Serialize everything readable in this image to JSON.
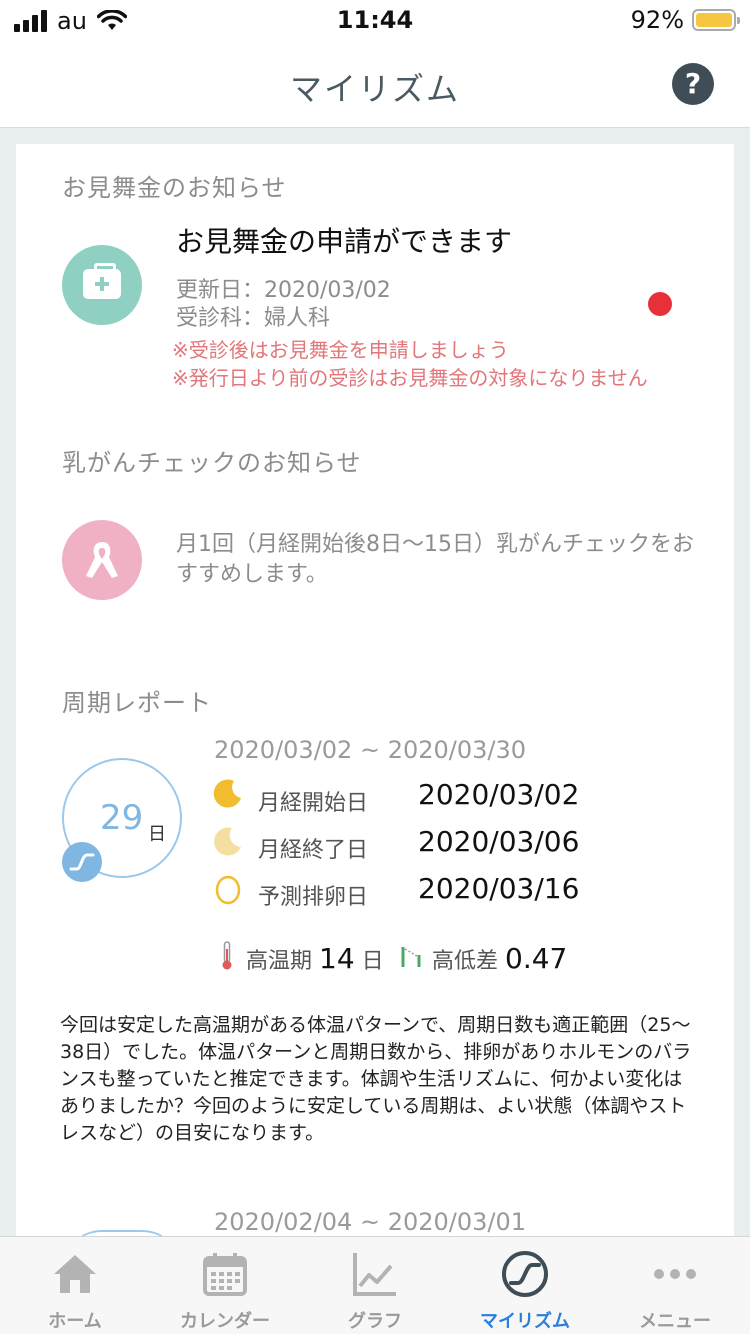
{
  "status_bar": {
    "carrier": "au",
    "time": "11:44",
    "battery": "92%"
  },
  "nav": {
    "title": "マイリズム",
    "help": "?"
  },
  "insurance": {
    "section_title": "お見舞金のお知らせ",
    "heading": "お見舞金の申請ができます",
    "updated": "更新日：2020/03/02",
    "department": "受診科：婦人科",
    "warning_1": "※受診後はお見舞金を申請しましょう",
    "warning_2": "※発行日より前の受診はお見舞金の対象になりません"
  },
  "breast_check": {
    "section_title": "乳がんチェックのお知らせ",
    "text": "月1回（月経開始後8日〜15日）乳がんチェックをおすすめします。"
  },
  "cycle_report": {
    "section_title": "周期レポート",
    "range": "2020/03/02 ~ 2020/03/30",
    "days": "29",
    "days_unit": "日",
    "rows": [
      {
        "label": "月経開始日",
        "date": "2020/03/02"
      },
      {
        "label": "月経終了日",
        "date": "2020/03/06"
      },
      {
        "label": "予測排卵日",
        "date": "2020/03/16"
      }
    ],
    "high_temp_label": "高温期",
    "high_temp_value": "14",
    "high_temp_unit": "日",
    "diff_label": "高低差",
    "diff_value": "0.47",
    "comment": "今回は安定した高温期がある体温パターンで、周期日数も適正範囲（25〜38日）でした。体温パターンと周期日数から、排卵がありホルモンのバランスも整っていたと推定できます。体調や生活リズムに、何かよい変化はありましたか？今回のように安定している周期は、よい状態（体調やストレスなど）の目安になります。",
    "next_range": "2020/02/04 ~ 2020/03/01"
  },
  "tabs": [
    {
      "label": "ホーム",
      "icon": "home-icon"
    },
    {
      "label": "カレンダー",
      "icon": "calendar-icon"
    },
    {
      "label": "グラフ",
      "icon": "graph-icon"
    },
    {
      "label": "マイリズム",
      "icon": "myrhythm-icon"
    },
    {
      "label": "メニュー",
      "icon": "menu-icon"
    }
  ],
  "colors": {
    "accent": "#2b7de0",
    "teal": "#8fd0c2",
    "pink": "#f1b1c4",
    "alert": "#e8303a",
    "warning_text": "#e2767a"
  }
}
